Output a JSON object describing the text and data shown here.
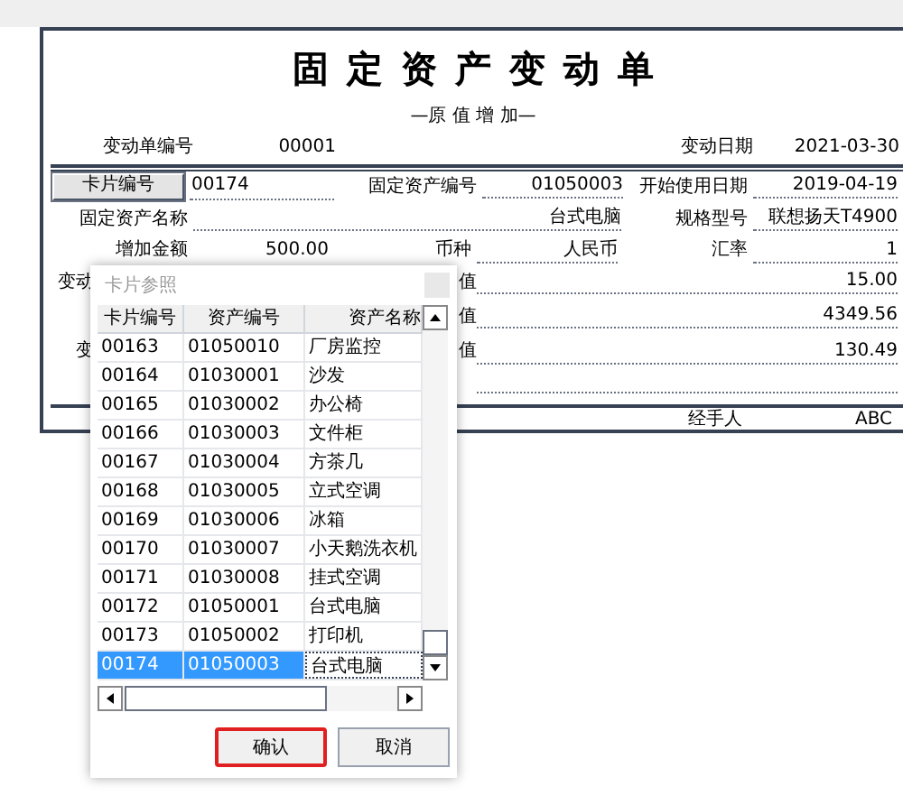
{
  "form": {
    "title": "固定资产变动单",
    "subtitle": "—原 值 增 加—",
    "header": [
      {
        "label": "变动单编号",
        "value": "00001"
      },
      {
        "label": "变动日期",
        "value": "2021-03-30"
      }
    ],
    "card_button": "卡片编号",
    "card_input": "00174",
    "asset_code": {
      "label": "固定资产编号",
      "value": "01050003"
    },
    "start_date": {
      "label": "开始使用日期",
      "value": "2019-04-19"
    },
    "asset_name": {
      "label": "固定资产名称",
      "value": "台式电脑"
    },
    "spec": {
      "label": "规格型号",
      "value": "联想扬天T4900"
    },
    "amount": {
      "label": "增加金额",
      "value": "500.00"
    },
    "currency": {
      "label": "币种",
      "value": "人民币"
    },
    "rate": {
      "label": "汇率",
      "value": "1"
    },
    "partial_rows": [
      {
        "left": "变动",
        "label": "值",
        "value": "15.00"
      },
      {
        "left": "",
        "label": "值",
        "value": "4349.56"
      },
      {
        "left": "变",
        "label": "值",
        "value": "130.49"
      }
    ],
    "handler": {
      "label": "经手人",
      "value": "ABC"
    }
  },
  "dialog": {
    "title": "卡片参照",
    "columns": [
      "卡片编号",
      "资产编号",
      "资产名称"
    ],
    "rows": [
      {
        "cells": [
          "00163",
          "01050010",
          "厂房监控"
        ],
        "selected": false
      },
      {
        "cells": [
          "00164",
          "01030001",
          "沙发"
        ],
        "selected": false
      },
      {
        "cells": [
          "00165",
          "01030002",
          "办公椅"
        ],
        "selected": false
      },
      {
        "cells": [
          "00166",
          "01030003",
          "文件柜"
        ],
        "selected": false
      },
      {
        "cells": [
          "00167",
          "01030004",
          "方茶几"
        ],
        "selected": false
      },
      {
        "cells": [
          "00168",
          "01030005",
          "立式空调"
        ],
        "selected": false
      },
      {
        "cells": [
          "00169",
          "01030006",
          "冰箱"
        ],
        "selected": false
      },
      {
        "cells": [
          "00170",
          "01030007",
          "小天鹅洗衣机"
        ],
        "selected": false
      },
      {
        "cells": [
          "00171",
          "01030008",
          "挂式空调"
        ],
        "selected": false
      },
      {
        "cells": [
          "00172",
          "01050001",
          "台式电脑"
        ],
        "selected": false
      },
      {
        "cells": [
          "00173",
          "01050002",
          "打印机"
        ],
        "selected": false
      },
      {
        "cells": [
          "00174",
          "01050003",
          "台式电脑"
        ],
        "selected": true
      }
    ],
    "buttons": [
      {
        "label": "确认",
        "highlighted": true
      },
      {
        "label": "取消",
        "highlighted": false
      }
    ]
  }
}
